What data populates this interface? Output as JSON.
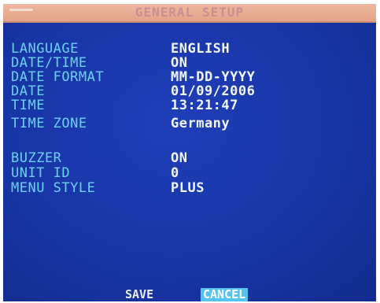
{
  "screen": {
    "title": "GENERAL SETUP",
    "colors": {
      "background": "#1835a6",
      "titlebar": "#e3a488",
      "label": "#6fd0f5",
      "value": "#f2f6ff",
      "selected": "#57c3f0"
    }
  },
  "settings": [
    {
      "label": "LANGUAGE",
      "value": "ENGLISH"
    },
    {
      "label": "DATE/TIME",
      "value": "ON"
    },
    {
      "label": "DATE FORMAT",
      "value": "MM-DD-YYYY"
    },
    {
      "label": "DATE",
      "value": "01/09/2006"
    },
    {
      "label": "TIME",
      "value": "13:21:47"
    },
    {
      "label": "TIME ZONE",
      "value": "Germany"
    },
    {
      "label": "BUZZER",
      "value": "ON"
    },
    {
      "label": "UNIT ID",
      "value": "0"
    },
    {
      "label": "MENU STYLE",
      "value": "PLUS"
    }
  ],
  "buttons": {
    "save_label": "SAVE",
    "cancel_label": "CANCEL",
    "selected": "cancel"
  }
}
